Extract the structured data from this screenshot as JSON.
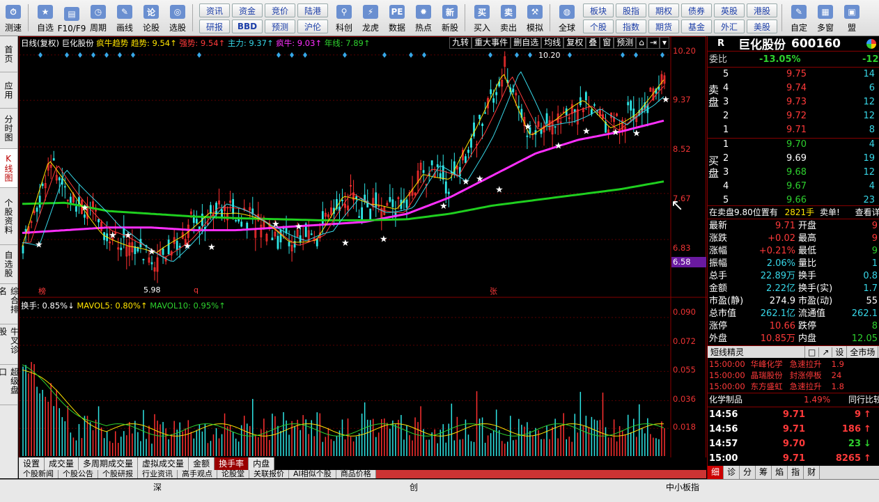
{
  "toolbar": {
    "single_left": [
      {
        "label": "测速",
        "icon": "speed-icon",
        "glyph": "⏱"
      }
    ],
    "main": [
      {
        "label": "自选",
        "icon": "watchlist-icon",
        "glyph": "★"
      },
      {
        "label": "F10/F9",
        "icon": "f10-icon",
        "glyph": "▤"
      },
      {
        "label": "周期",
        "icon": "period-icon",
        "glyph": "◷"
      },
      {
        "label": "画线",
        "icon": "draw-line-icon",
        "glyph": "✎"
      },
      {
        "label": "论股",
        "icon": "forum-icon",
        "glyph": "论"
      },
      {
        "label": "选股",
        "icon": "stock-picker-icon",
        "glyph": "◎"
      }
    ],
    "grid1": [
      "资讯",
      "资金",
      "竞价",
      "陆港",
      "研报",
      "BBD",
      "预测",
      "沪伦"
    ],
    "mid": [
      {
        "label": "科创",
        "icon": "star-market-icon",
        "glyph": "⚲"
      },
      {
        "label": "龙虎",
        "icon": "dragon-tiger-icon",
        "glyph": "⚡"
      },
      {
        "label": "数据",
        "icon": "data-pe-icon",
        "glyph": "PE"
      },
      {
        "label": "热点",
        "icon": "hot-icon",
        "glyph": "✹"
      },
      {
        "label": "新股",
        "icon": "ipo-icon",
        "glyph": "新"
      }
    ],
    "trade": [
      {
        "label": "买入",
        "icon": "buy-icon",
        "glyph": "买"
      },
      {
        "label": "卖出",
        "icon": "sell-icon",
        "glyph": "卖"
      },
      {
        "label": "模拟",
        "icon": "simulate-icon",
        "glyph": "⚒"
      }
    ],
    "globe": {
      "label": "全球",
      "icon": "globe-icon",
      "glyph": "◍"
    },
    "grid2": [
      "板块",
      "股指",
      "期权",
      "债券",
      "英股",
      "港股",
      "个股",
      "指数",
      "期货",
      "基金",
      "外汇",
      "美股"
    ],
    "right": [
      {
        "label": "自定",
        "icon": "custom-icon",
        "glyph": "✎"
      },
      {
        "label": "多窗",
        "icon": "multiwindow-icon",
        "glyph": "▦"
      },
      {
        "label": "盟",
        "icon": "league-icon",
        "glyph": "▣"
      }
    ]
  },
  "left_tabs": [
    {
      "label": "首页",
      "active": false
    },
    {
      "label": "应用",
      "active": false
    },
    {
      "label": "分时图",
      "active": false
    },
    {
      "label": "K线图",
      "active": true
    },
    {
      "label": "个股资料",
      "active": false
    },
    {
      "label": "自选股",
      "active": false
    },
    {
      "label": "综合排名",
      "active": false
    },
    {
      "label": "牛叉诊股",
      "active": false
    },
    {
      "label": "超级盘口",
      "active": false
    }
  ],
  "chart": {
    "indicator_line": {
      "prefix": "日线(复权) 巨化股份 ",
      "name": "疯牛趋势",
      "qushi": "趋势: 9.54↑",
      "qiangshi": "强势: 9.54↑",
      "zhuli": "主力: 9.37↑",
      "fengniu": "疯牛: 9.03↑",
      "nianxian": "年线: 7.89↑"
    },
    "buttons": [
      "九转",
      "重大事件",
      "删自选",
      "均线",
      "复权",
      "叠",
      "窗",
      "预测",
      "⌂",
      "⇥",
      "▾"
    ],
    "price_axis": [
      "10.20",
      "9.37",
      "8.52",
      "7.67",
      "6.83"
    ],
    "current_price_tag": "6.58",
    "high_label": "10.20",
    "low_label": "5.98",
    "markers": {
      "bang": "榜",
      "q": "q",
      "zhang": "张"
    },
    "vol_line": {
      "huanshou": "换手: 0.85%↓",
      "mavol5": "MAVOL5: 0.80%↑",
      "mavol10": "MAVOL10: 0.95%↑"
    },
    "vol_axis": [
      "0.090",
      "0.072",
      "0.055",
      "0.036",
      "0.018"
    ]
  },
  "chart_data": {
    "type": "candlestick",
    "title": "",
    "ylim": [
      5.8,
      10.3
    ],
    "vol_ylim": [
      0,
      0.095
    ],
    "ma_series": [
      {
        "name": "",
        "color": "#ff2fff",
        "values": [
          6.95,
          7.0,
          7.05,
          7.05,
          7.0,
          7.0,
          7.05,
          7.1,
          7.15,
          7.3,
          7.6,
          8.0,
          8.4,
          8.65,
          8.8,
          9.0
        ]
      },
      {
        "name": "",
        "color": "#1fcf1f",
        "values": [
          7.48,
          7.5,
          7.35,
          7.3,
          7.25,
          7.22,
          7.2,
          7.18,
          7.18,
          7.2,
          7.3,
          7.45,
          7.55,
          7.65,
          7.75,
          7.89
        ]
      }
    ],
    "k_values": [
      6.7,
      8.2,
      7.6,
      7.0,
      6.7,
      6.5,
      6.9,
      7.4,
      7.3,
      7.1,
      6.8,
      6.9,
      7.6,
      7.4,
      7.4,
      8.1,
      7.9,
      8.8,
      9.9,
      8.8,
      9.0,
      9.3,
      8.9,
      9.2,
      9.71
    ]
  },
  "bottom_tabs": [
    "设置",
    "成交量",
    "多周期成交量",
    "虚拟成交量",
    "金额",
    "换手率",
    "内盘"
  ],
  "bottom_tabs_active": "换手率",
  "bottom_tabs2": [
    "个股新闻",
    "个股公告",
    "个股研报",
    "行业资讯",
    "高手观点",
    "论股堂",
    "关联报价",
    "AI相似个股",
    "商品价格"
  ],
  "status": {
    "items": [
      "深",
      "创",
      "中小板指"
    ]
  },
  "right": {
    "title_r": "R",
    "name": "巨化股份",
    "code": "600160",
    "weibi_label": "委比",
    "weibi_value": "-13.05%",
    "weibi_diff": "-12",
    "sell_label": "卖盘",
    "buy_label": "买盘",
    "asks": [
      {
        "n": "5",
        "price": "9.75",
        "vol": "14"
      },
      {
        "n": "4",
        "price": "9.74",
        "vol": "6"
      },
      {
        "n": "3",
        "price": "9.73",
        "vol": "12"
      },
      {
        "n": "2",
        "price": "9.72",
        "vol": "12"
      },
      {
        "n": "1",
        "price": "9.71",
        "vol": "8"
      }
    ],
    "bids": [
      {
        "n": "1",
        "price": "9.70",
        "vol": "4"
      },
      {
        "n": "2",
        "price": "9.69",
        "vol": "19"
      },
      {
        "n": "3",
        "price": "9.68",
        "vol": "12"
      },
      {
        "n": "4",
        "price": "9.67",
        "vol": "4"
      },
      {
        "n": "5",
        "price": "9.66",
        "vol": "23"
      }
    ],
    "order_notice": {
      "text": "在卖盘9.80位置有",
      "vol": "2821手",
      "tag": "卖单!",
      "link": "查看详"
    },
    "quote": [
      {
        "l": "最新",
        "v": "9.71",
        "vc": "red",
        "l2": "开盘",
        "v2": "9",
        "v2c": "red"
      },
      {
        "l": "涨跌",
        "v": "+0.02",
        "vc": "red",
        "l2": "最高",
        "v2": "9",
        "v2c": "red"
      },
      {
        "l": "涨幅",
        "v": "+0.21%",
        "vc": "red",
        "l2": "最低",
        "v2": "9",
        "v2c": "green"
      },
      {
        "l": "振幅",
        "v": "2.06%",
        "vc": "cyan",
        "l2": "量比",
        "v2": "1",
        "v2c": "cyan"
      },
      {
        "l": "总手",
        "v": "22.89万",
        "vc": "cyan",
        "l2": "换手",
        "v2": "0.8",
        "v2c": "cyan"
      },
      {
        "l": "金额",
        "v": "2.22亿",
        "vc": "cyan",
        "l2": "换手(实)",
        "v2": "1.7",
        "v2c": "cyan"
      },
      {
        "l": "市盈(静)",
        "v": "274.9",
        "vc": "white",
        "l2": "市盈(动)",
        "v2": "55",
        "v2c": "white"
      },
      {
        "l": "总市值",
        "v": "262.1亿",
        "vc": "cyan",
        "l2": "流通值",
        "v2": "262.1",
        "v2c": "cyan"
      },
      {
        "l": "涨停",
        "v": "10.66",
        "vc": "red",
        "l2": "跌停",
        "v2": "8",
        "v2c": "green"
      },
      {
        "l": "外盘",
        "v": "10.85万",
        "vc": "red",
        "l2": "内盘",
        "v2": "12.05",
        "v2c": "green"
      }
    ],
    "jingling_tabs": [
      "短线精灵",
      "□",
      "↗",
      "设",
      "全市场"
    ],
    "news": [
      {
        "time": "15:00:00",
        "name": "华峰化学",
        "event": "急速拉升",
        "val": "1.9"
      },
      {
        "time": "15:00:00",
        "name": "晶瑞股份",
        "event": "封涨停板",
        "val": "24"
      },
      {
        "time": "15:00:00",
        "name": "东方盛虹",
        "event": "急速拉升",
        "val": "1.8"
      }
    ],
    "industry": {
      "name": "化学制品",
      "pct": "1.49%",
      "compare": "同行比较"
    },
    "ticks": [
      {
        "time": "14:56",
        "price": "9.71",
        "vol": "9",
        "dir": "↑",
        "dirc": "red"
      },
      {
        "time": "14:56",
        "price": "9.71",
        "vol": "186",
        "dir": "↑",
        "dirc": "red"
      },
      {
        "time": "14:57",
        "price": "9.70",
        "vol": "23",
        "dir": "↓",
        "dirc": "green"
      },
      {
        "time": "15:00",
        "price": "9.71",
        "vol": "8265",
        "dir": "↑",
        "dirc": "red"
      }
    ],
    "bottom_tabs": [
      "细",
      "诊",
      "分",
      "筹",
      "焰",
      "指",
      "财"
    ]
  }
}
